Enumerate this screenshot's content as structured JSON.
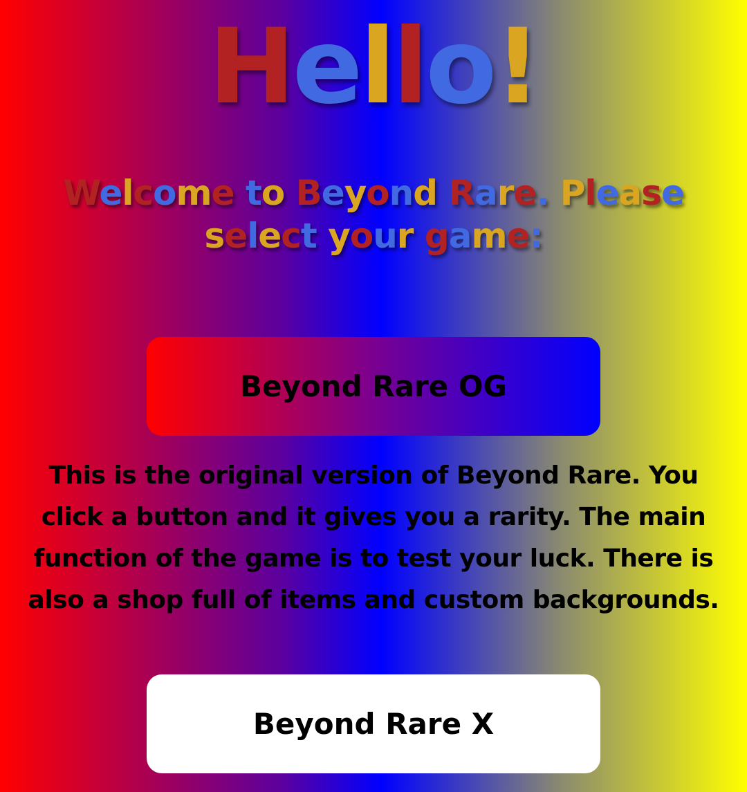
{
  "header": {
    "title_letters": [
      "H",
      "e",
      "l",
      "l",
      "o",
      "!"
    ],
    "title_colors": [
      "#b22222",
      "#4169e1",
      "#daa520",
      "#b22222",
      "#4169e1",
      "#daa520"
    ]
  },
  "welcome": {
    "text": "Welcome to Beyond Rare. Please select your game:",
    "palette": [
      "#b22222",
      "#4169e1",
      "#daa520"
    ]
  },
  "games": [
    {
      "button_label": "Beyond Rare OG",
      "description": "This is the original version of Beyond Rare. You click a button and it gives you a rarity. The main function of the game is to test your luck. There is also a shop full of items and custom backgrounds."
    },
    {
      "button_label": "Beyond Rare X"
    }
  ],
  "colors": {
    "background_gradient": [
      "#ff0000",
      "#0000ff",
      "#ffff00"
    ],
    "og_button_gradient": [
      "#ff0000",
      "#0000ff"
    ],
    "x_button_bg": "#ffffff"
  }
}
